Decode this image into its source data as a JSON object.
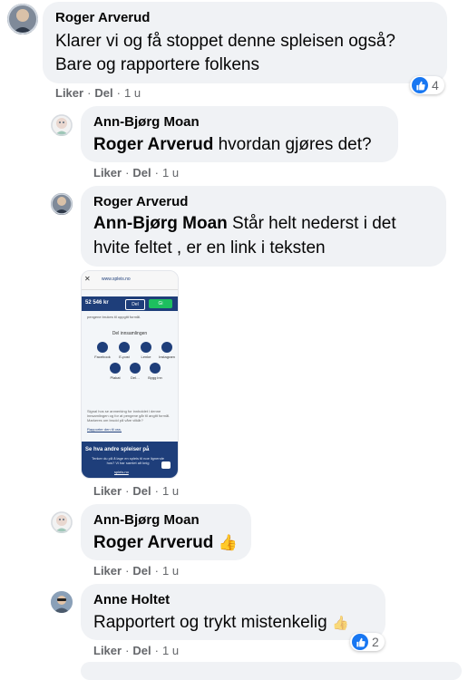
{
  "comments": [
    {
      "author": "Roger Arverud",
      "text_line1": "Klarer vi og få stoppet denne spleisen også?",
      "text_line2": "Bare og rapportere folkens",
      "action_like": "Liker",
      "action_reply": "Del",
      "time": "1 u",
      "reaction_count": "4"
    },
    {
      "author": "Ann-Bjørg Moan",
      "mention": "Roger Arverud",
      "text": "hvordan gjøres det?",
      "action_like": "Liker",
      "action_reply": "Del",
      "time": "1 u"
    },
    {
      "author": "Roger Arverud",
      "mention": "Ann-Bjørg Moan",
      "text_line1": "Står helt nederst i det",
      "text_line2": "hvite feltet , er en link i teksten",
      "action_like": "Liker",
      "action_reply": "Del",
      "time": "1 u",
      "attachment": {
        "url": "www.spleis.no",
        "amount": "52 546 kr",
        "del_button": "Del",
        "gi_button": "Gi",
        "intro_text": "pengene brukes til oppgitt formål.",
        "share_heading": "Del innsamlingen",
        "share_items": [
          "Facebook",
          "E-post",
          "Lenke",
          "Instagram",
          "Plakat",
          "Del…",
          "Bygg inn"
        ],
        "body_text": "Signal hos se anmerking for innholdet i denne innsamlingen og for at pengene går til angitt formål. Markeres om brudd på våre vilkår?",
        "report_link": "Rapporter den til oss.",
        "footer_heading": "Se hva andre spleiser på",
        "footer_text": "Tenker du på å lage en spleis til noe lignende hos? Vi har samlet alt knig",
        "footer_link": "spleis.no"
      }
    },
    {
      "author": "Ann-Bjørg Moan",
      "mention": "Roger Arverud",
      "emoji": "👍",
      "action_like": "Liker",
      "action_reply": "Del",
      "time": "1 u"
    },
    {
      "author": "Anne Holtet",
      "text": "Rapportert og trykt mistenkelig",
      "emoji": "👍",
      "action_like": "Liker",
      "action_reply": "Del",
      "time": "1 u",
      "reaction_count": "2"
    }
  ],
  "colors": {
    "bubble": "#f0f2f5",
    "like_blue": "#1877f2",
    "meta_gray": "#65676b",
    "spleis_green": "#1dbf5f",
    "spleis_navy": "#1e3e7a"
  }
}
